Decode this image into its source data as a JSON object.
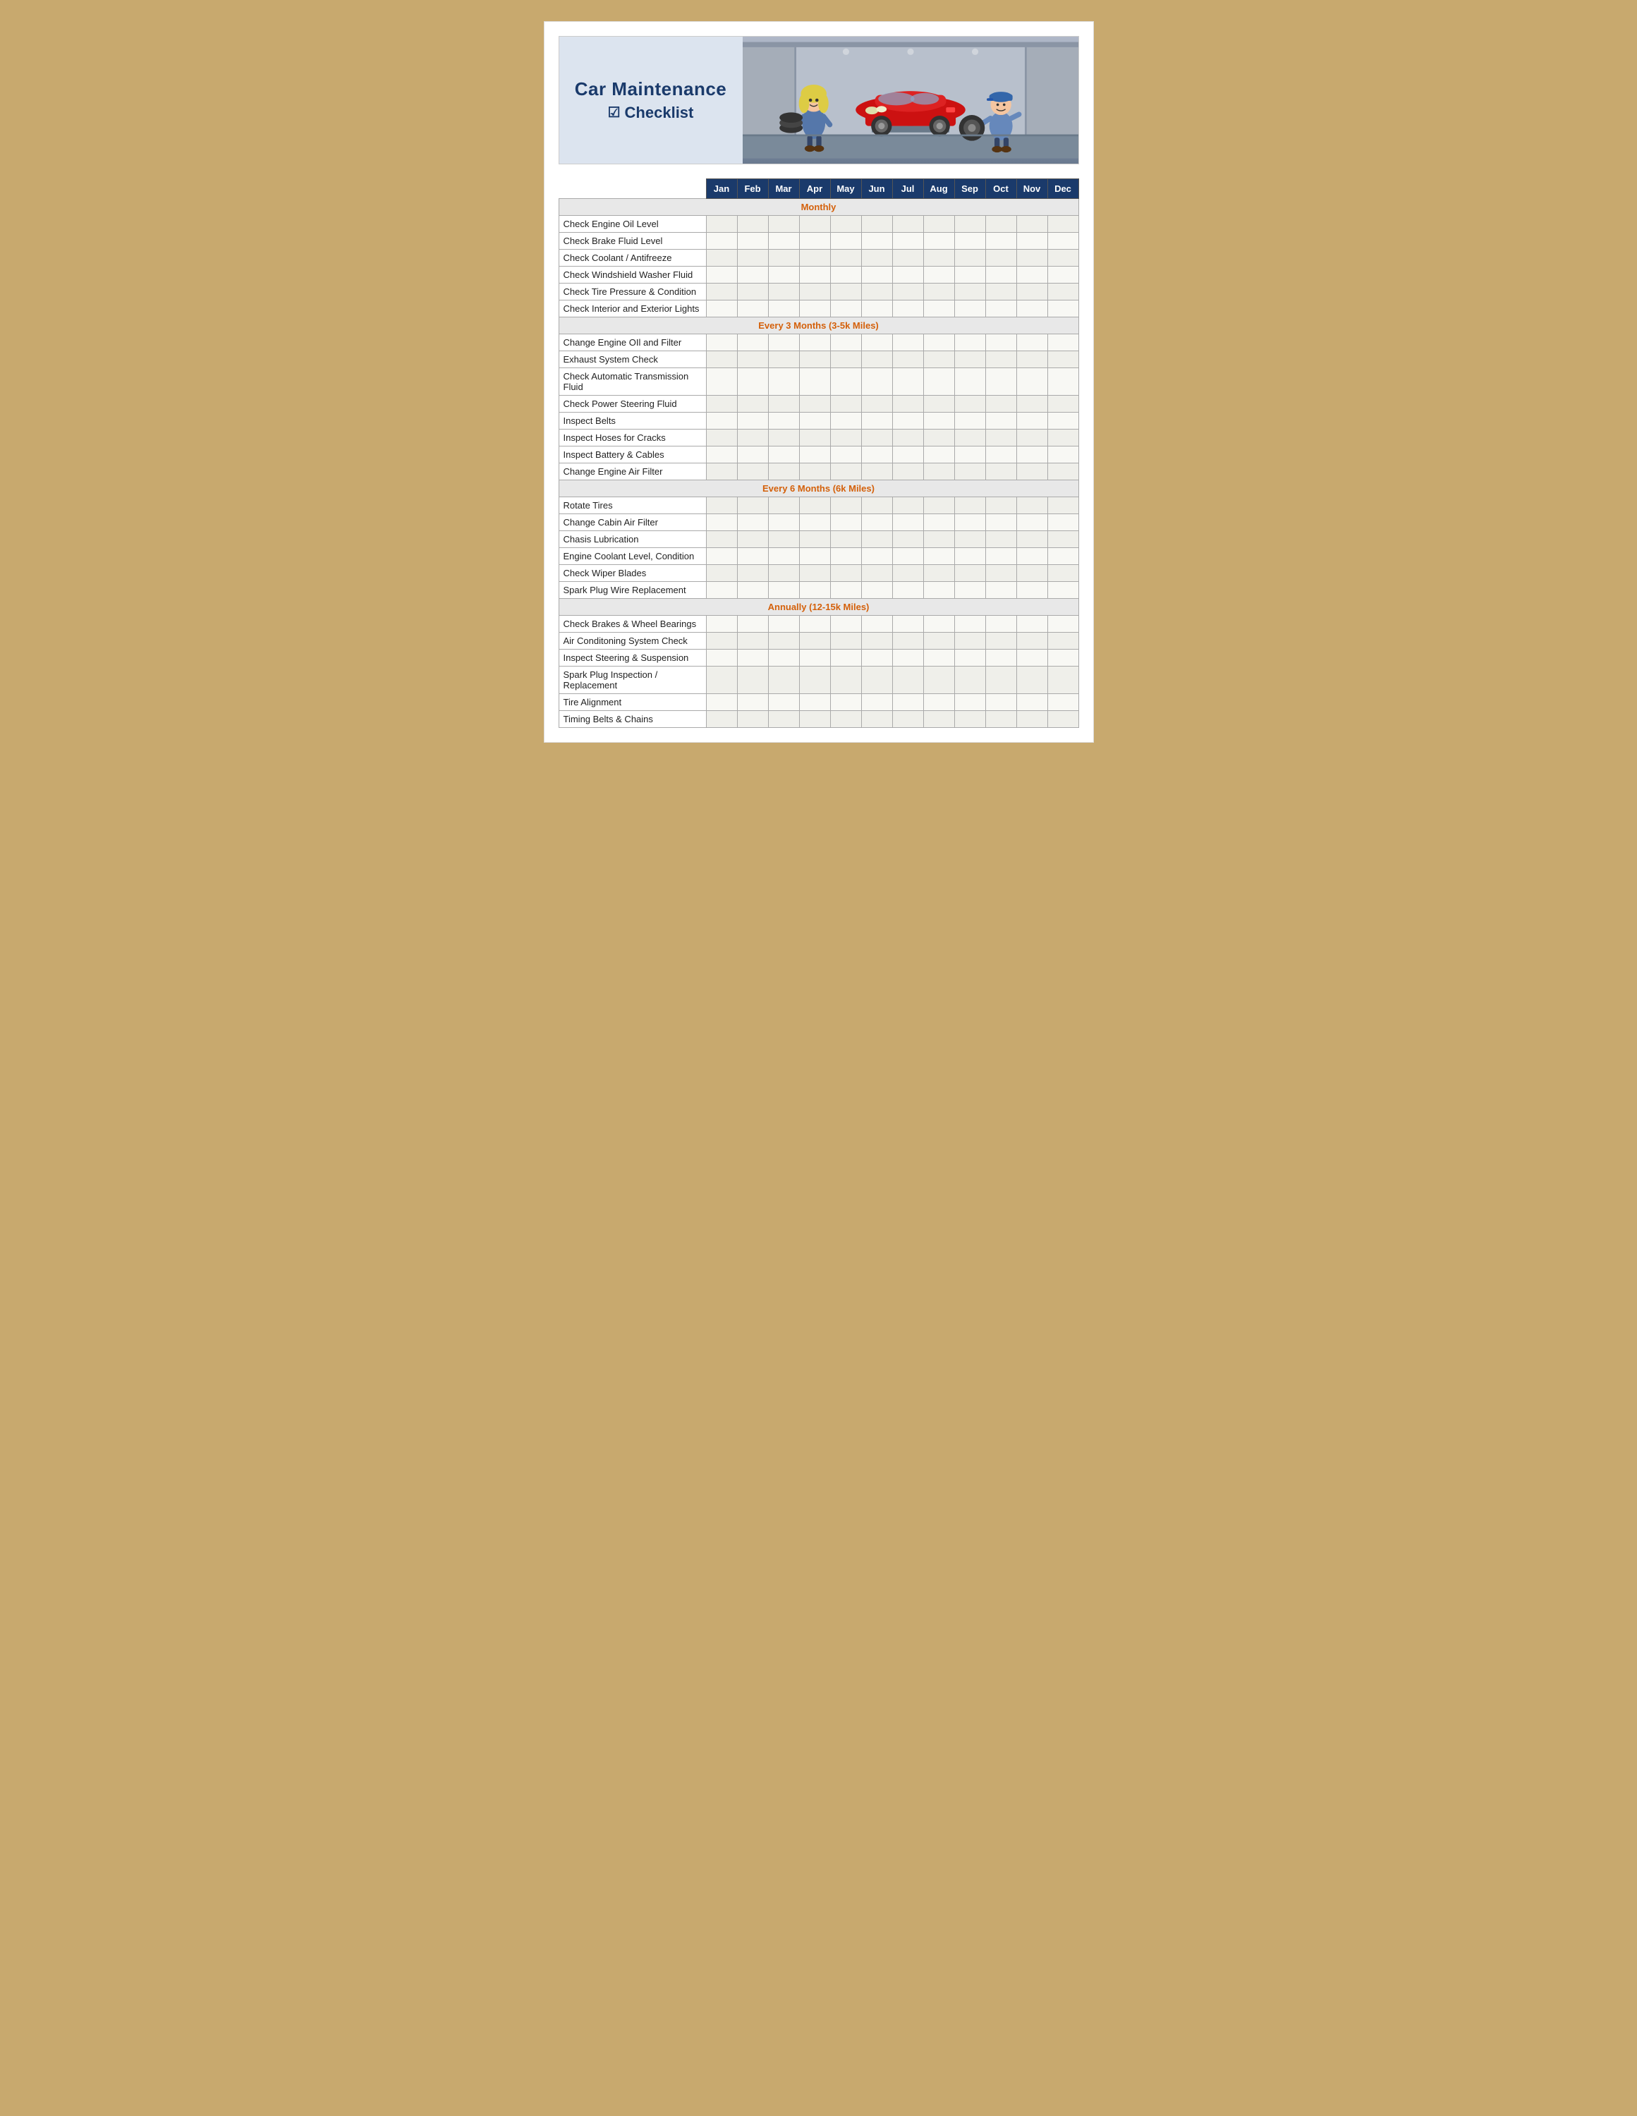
{
  "header": {
    "title_line1": "Car Maintenance",
    "title_line2": "Checklist"
  },
  "months": [
    "Jan",
    "Feb",
    "Mar",
    "Apr",
    "May",
    "Jun",
    "Jul",
    "Aug",
    "Sep",
    "Oct",
    "Nov",
    "Dec"
  ],
  "sections": [
    {
      "category": "Monthly",
      "items": [
        "Check Engine Oil Level",
        "Check Brake Fluid Level",
        "Check Coolant / Antifreeze",
        "Check Windshield Washer Fluid",
        "Check Tire Pressure & Condition",
        "Check Interior and Exterior Lights"
      ]
    },
    {
      "category": "Every 3 Months (3-5k Miles)",
      "items": [
        "Change Engine OIl and Filter",
        "Exhaust System Check",
        "Check Automatic Transmission Fluid",
        "Check Power Steering Fluid",
        "Inspect Belts",
        "Inspect Hoses for Cracks",
        "Inspect Battery & Cables",
        "Change Engine Air Filter"
      ]
    },
    {
      "category": "Every 6 Months (6k Miles)",
      "items": [
        "Rotate Tires",
        "Change Cabin Air Filter",
        "Chasis Lubrication",
        "Engine Coolant Level, Condition",
        "Check Wiper Blades",
        "Spark Plug Wire Replacement"
      ]
    },
    {
      "category": "Annually (12-15k Miles)",
      "items": [
        "Check Brakes & Wheel Bearings",
        "Air Conditoning System Check",
        "Inspect Steering & Suspension",
        "Spark Plug Inspection / Replacement",
        "Tire Alignment",
        "Timing Belts & Chains"
      ]
    }
  ]
}
